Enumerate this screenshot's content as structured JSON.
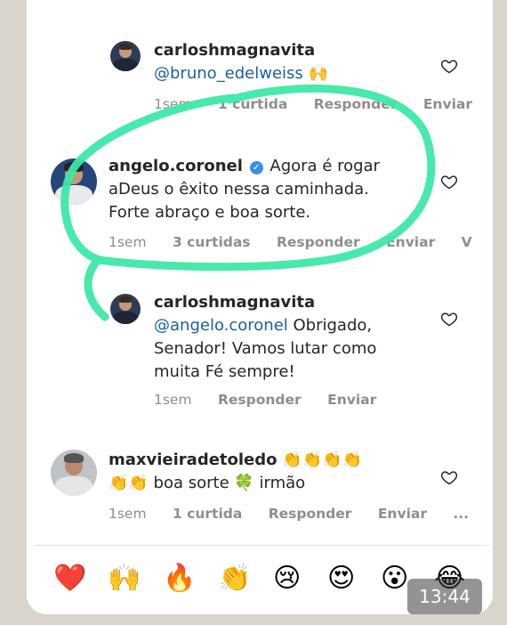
{
  "comments": [
    {
      "username": "carloshmagnavita",
      "text_line1": "@bruno_edelweiss 🙌",
      "meta": {
        "time": "1sem",
        "likes": "1 curtida",
        "reply": "Responder",
        "send": "Enviar"
      }
    },
    {
      "username": "angelo.coronel",
      "text_line1": "Agora é rogar",
      "text_line2": "aDeus o êxito nessa caminhada.",
      "text_line3": "Forte abraço e boa sorte.",
      "meta": {
        "time": "1sem",
        "likes": "3 curtidas",
        "reply": "Responder",
        "send": "Enviar",
        "more": "V"
      }
    },
    {
      "username": "carloshmagnavita",
      "mention": "@angelo.coronel",
      "text_line1": "Obrigado,",
      "text_line2": "Senador!  Vamos lutar como",
      "text_line3": "muita Fé sempre!",
      "meta": {
        "time": "1sem",
        "reply": "Responder",
        "send": "Enviar"
      }
    },
    {
      "username": "maxvieiradetoledo",
      "text_line1": "👏👏👏👏",
      "text_line2": "👏👏 boa sorte 🍀 irmão",
      "meta": {
        "time": "1sem",
        "likes": "1 curtida",
        "reply": "Responder",
        "send": "Enviar",
        "more": "..."
      }
    }
  ],
  "reactions": [
    "❤️",
    "🙌",
    "🔥",
    "👏",
    "😢",
    "😍",
    "😮",
    "😂"
  ],
  "status_time": "13:44",
  "colors": {
    "annotation": "#3de8a8",
    "mention": "#1b5fa8",
    "meta": "#8e8e8e"
  }
}
